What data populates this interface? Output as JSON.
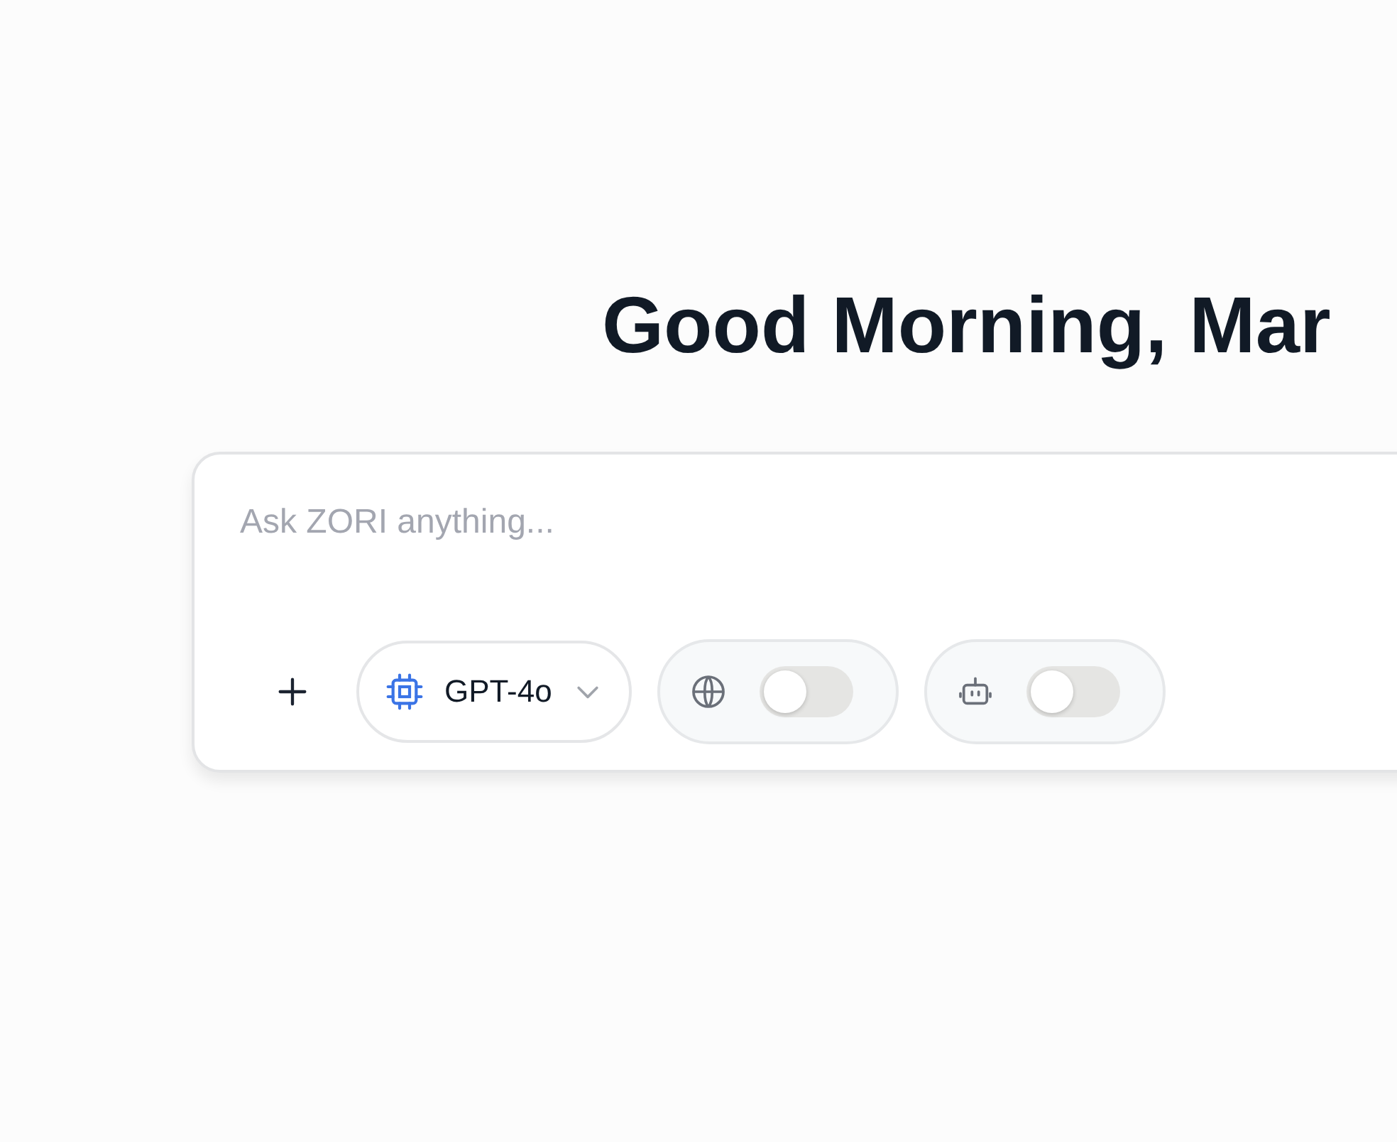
{
  "greeting": "Good Morning, Mar",
  "composer": {
    "placeholder": "Ask ZORI anything...",
    "model_select": {
      "value": "GPT-4o"
    },
    "toggles": [
      {
        "kind": "globe",
        "on": false
      },
      {
        "kind": "bot",
        "on": false
      }
    ]
  }
}
